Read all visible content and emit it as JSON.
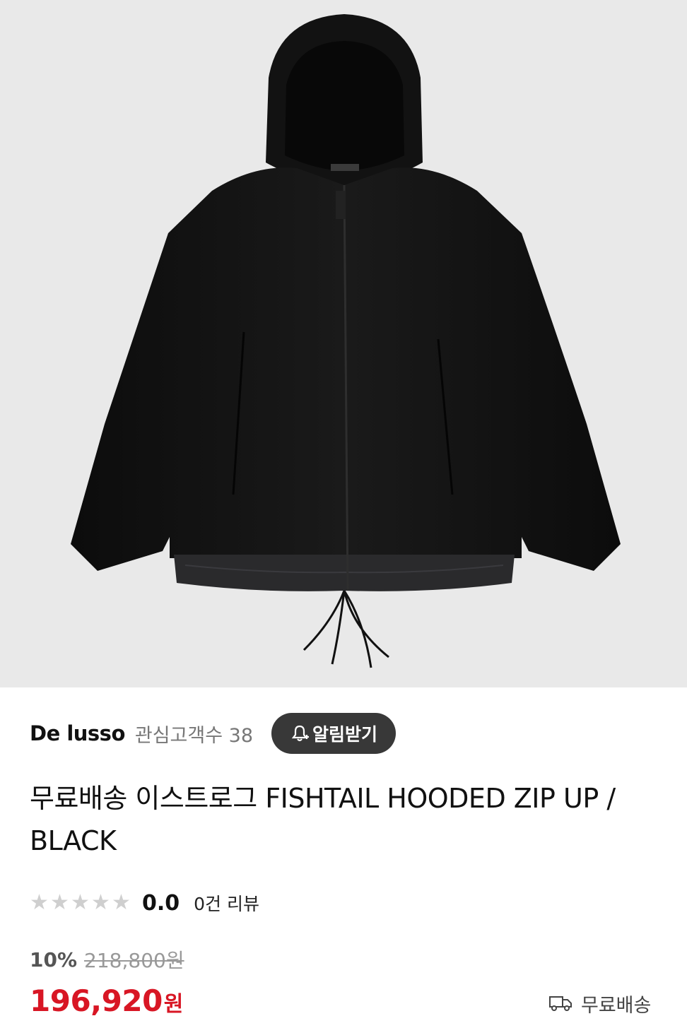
{
  "product_image": {
    "alt": "FISHTAIL HOODED ZIP UP BLACK"
  },
  "seller": {
    "name": "De lusso",
    "favorites_label": "관심고객수 38",
    "alarm_button": "알림받기"
  },
  "product": {
    "title": "무료배송 이스트로그 FISHTAIL HOODED ZIP UP / BLACK"
  },
  "rating": {
    "stars_filled": 0,
    "stars_total": 5,
    "score": "0.0",
    "review_count": "0건 리뷰"
  },
  "price": {
    "discount": "10%",
    "original": "218,800원",
    "current": "196,920",
    "currency": "원",
    "color": "#d81624"
  },
  "shipping": {
    "label": "무료배송",
    "icon": "truck-icon"
  }
}
